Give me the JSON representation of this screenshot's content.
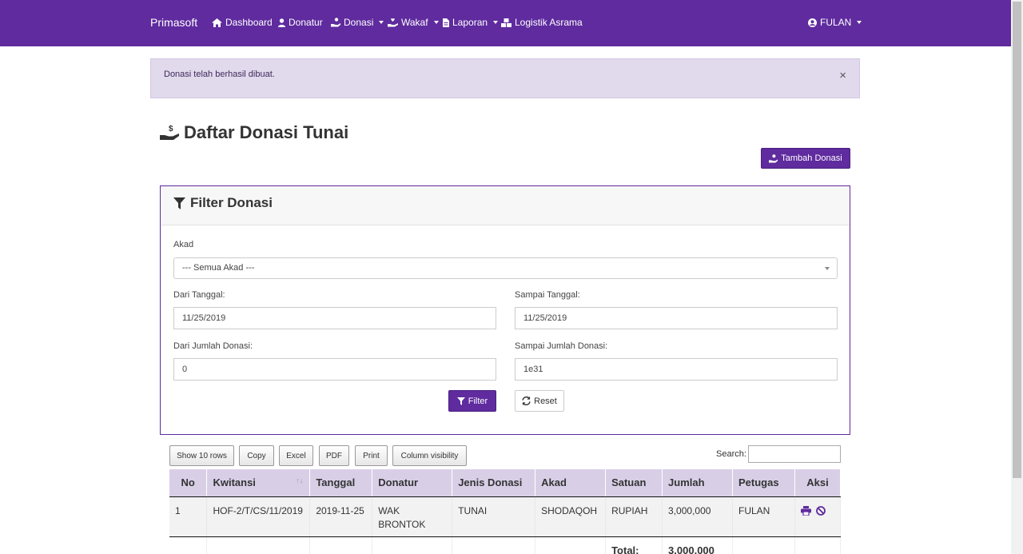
{
  "navbar": {
    "brand": "Primasoft",
    "items": [
      {
        "label": "Dashboard",
        "icon": "home-icon"
      },
      {
        "label": "Donatur",
        "icon": "user-icon"
      },
      {
        "label": "Donasi",
        "icon": "hand-coin-icon",
        "dropdown": true
      },
      {
        "label": "Wakaf",
        "icon": "hand-heart-icon",
        "dropdown": true
      },
      {
        "label": "Laporan",
        "icon": "file-icon",
        "dropdown": true
      },
      {
        "label": "Logistik Asrama",
        "icon": "cubes-icon"
      }
    ],
    "user": {
      "label": "FULAN",
      "icon": "user-circle-icon"
    }
  },
  "alert": {
    "message": "Donasi telah berhasil dibuat.",
    "close": "×"
  },
  "page": {
    "title": "Daftar Donasi Tunai",
    "add_button": "Tambah Donasi"
  },
  "filter": {
    "title": "Filter Donasi",
    "akad_label": "Akad",
    "akad_value": "--- Semua Akad ---",
    "dari_tanggal_label": "Dari Tanggal:",
    "dari_tanggal_value": "11/25/2019",
    "sampai_tanggal_label": "Sampai Tanggal:",
    "sampai_tanggal_value": "11/25/2019",
    "dari_jumlah_label": "Dari Jumlah Donasi:",
    "dari_jumlah_value": "0",
    "sampai_jumlah_label": "Sampai Jumlah Donasi:",
    "sampai_jumlah_value": "1e31",
    "filter_button": "Filter",
    "reset_button": "Reset"
  },
  "table_tools": {
    "buttons": [
      "Show 10 rows",
      "Copy",
      "Excel",
      "PDF",
      "Print",
      "Column visibility"
    ],
    "search_label": "Search:"
  },
  "table": {
    "headers": [
      "No",
      "Kwitansi",
      "Tanggal",
      "Donatur",
      "Jenis Donasi",
      "Akad",
      "Satuan",
      "Jumlah",
      "Petugas",
      "Aksi"
    ],
    "rows": [
      {
        "no": "1",
        "kwitansi": "HOF-2/T/CS/11/2019",
        "tanggal": "2019-11-25",
        "donatur": "WAK BRONTOK",
        "jenis": "TUNAI",
        "akad": "SHODAQOH",
        "satuan": "RUPIAH",
        "jumlah": "3,000,000",
        "petugas": "FULAN"
      }
    ],
    "total_label": "Total:",
    "total_value": "3,000,000"
  },
  "colors": {
    "primary": "#5f2b9e",
    "alert_bg": "#e1d9ec",
    "table_header": "#d8cfe7"
  }
}
